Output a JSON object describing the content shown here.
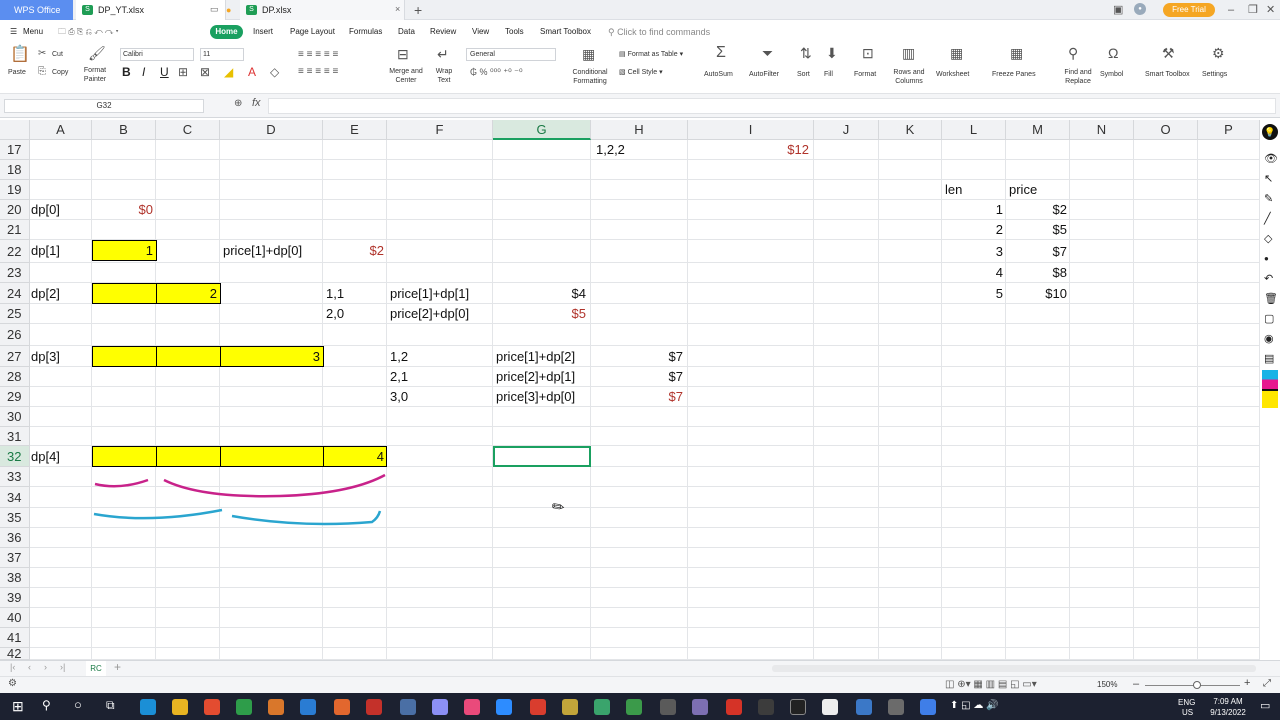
{
  "titlebar": {
    "app_tab": "WPS Office",
    "tabs": [
      {
        "label": "DP_YT.xlsx"
      },
      {
        "label": "DP.xlsx"
      }
    ],
    "free_trial": "Free Trial"
  },
  "menu": {
    "menu_label": "Menu",
    "items": [
      "Home",
      "Insert",
      "Page Layout",
      "Formulas",
      "Data",
      "Review",
      "View",
      "Tools",
      "Smart Toolbox"
    ],
    "search_placeholder": "Click to find commands"
  },
  "ribbon": {
    "paste": "Paste",
    "cut": "Cut",
    "copy": "Copy",
    "format_painter": "Format Painter",
    "font": "Calibri",
    "font_size": "11",
    "bold": "B",
    "italic": "I",
    "underline": "U",
    "merge_center": "Merge and Center",
    "wrap_text": "Wrap Text",
    "number_format": "General",
    "conditional_formatting": "Conditional Formatting",
    "format_as_table": "Format as Table",
    "cell_style": "Cell Style",
    "autosum": "AutoSum",
    "autofilter": "AutoFilter",
    "sort": "Sort",
    "fill": "Fill",
    "format": "Format",
    "rows_columns": "Rows and Columns",
    "worksheet": "Worksheet",
    "freeze_panes": "Freeze Panes",
    "find_replace": "Find and Replace",
    "symbol": "Symbol",
    "smart_toolbox": "Smart Toolbox",
    "settings": "Settings"
  },
  "formula_bar": {
    "name_box": "G32",
    "fx": "fx",
    "formula": ""
  },
  "columns": [
    "A",
    "B",
    "C",
    "D",
    "E",
    "F",
    "G",
    "H",
    "I",
    "J",
    "K",
    "L",
    "M",
    "N",
    "O",
    "P"
  ],
  "rows": [
    "17",
    "18",
    "19",
    "20",
    "21",
    "22",
    "23",
    "24",
    "25",
    "26",
    "27",
    "28",
    "29",
    "30",
    "31",
    "32",
    "33",
    "34",
    "35",
    "36",
    "37",
    "38",
    "39",
    "40",
    "41",
    "42"
  ],
  "cells": {
    "h17": "1,2,2",
    "i17": "$12",
    "l19": "len",
    "m19": "price",
    "a20": "dp[0]",
    "b20": "$0",
    "a22": "dp[1]",
    "b22": "1",
    "d22": "price[1]+dp[0]",
    "e22": "$2",
    "a24": "dp[2]",
    "c24": "2",
    "e24": "1,1",
    "f24": "price[1]+dp[1]",
    "g24": "$4",
    "e25": "2,0",
    "f25": "price[2]+dp[0]",
    "g25": "$5",
    "a27": "dp[3]",
    "d27": "3",
    "f27": "1,2",
    "g27": "price[1]+dp[2]",
    "h27": "$7",
    "f28": "2,1",
    "g28": "price[2]+dp[1]",
    "h28": "$7",
    "f29": "3,0",
    "g29": "price[3]+dp[0]",
    "h29": "$7",
    "a32": "dp[4]",
    "e32": "4"
  },
  "len_table": {
    "len": [
      "1",
      "2",
      "3",
      "4",
      "5"
    ],
    "price": [
      "$2",
      "$5",
      "$7",
      "$8",
      "$10"
    ]
  },
  "sheet_tab": "RC",
  "status": {
    "zoom": "150%"
  },
  "taskbar": {
    "lang": "ENG",
    "region": "US",
    "time": "7:09 AM",
    "date": "9/13/2022"
  }
}
